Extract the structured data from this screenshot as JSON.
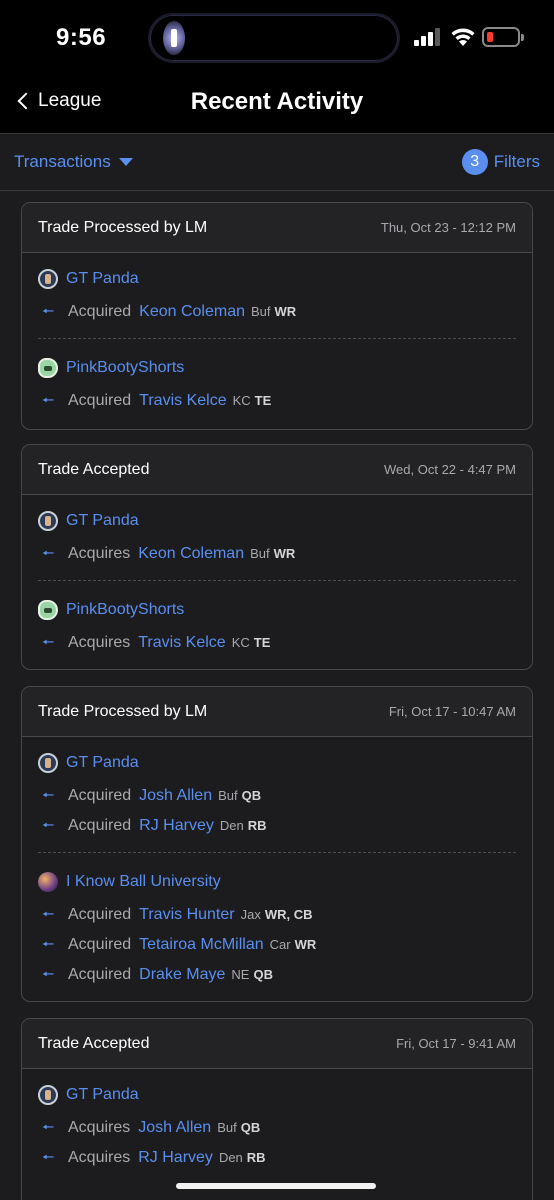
{
  "status": {
    "time": "9:56"
  },
  "nav": {
    "back_label": "League",
    "title": "Recent Activity"
  },
  "filterbar": {
    "transactions_label": "Transactions",
    "filter_count": "3",
    "filters_label": "Filters"
  },
  "colors": {
    "accent": "#5a8ff0",
    "background": "#1c1c1e",
    "header": "#000000",
    "muted_text": "#a9a9ad",
    "battery_low": "#ff3b30"
  },
  "cards": [
    {
      "title": "Trade Processed by LM",
      "date": "Thu, Oct 23 - 12:12 PM",
      "groups": [
        {
          "team": "GT Panda",
          "avatar": "panda-avatar-icon",
          "items": [
            {
              "verb": "Acquired",
              "player": "Keon Coleman",
              "team": "Buf",
              "pos": "WR"
            }
          ]
        },
        {
          "team": "PinkBootyShorts",
          "avatar": "helmet-avatar-icon",
          "items": [
            {
              "verb": "Acquired",
              "player": "Travis Kelce",
              "team": "KC",
              "pos": "TE"
            }
          ]
        }
      ]
    },
    {
      "title": "Trade Accepted",
      "date": "Wed, Oct 22 - 4:47 PM",
      "groups": [
        {
          "team": "GT Panda",
          "avatar": "panda-avatar-icon",
          "items": [
            {
              "verb": "Acquires",
              "player": "Keon Coleman",
              "team": "Buf",
              "pos": "WR"
            }
          ]
        },
        {
          "team": "PinkBootyShorts",
          "avatar": "helmet-avatar-icon",
          "items": [
            {
              "verb": "Acquires",
              "player": "Travis Kelce",
              "team": "KC",
              "pos": "TE"
            }
          ]
        }
      ]
    },
    {
      "title": "Trade Processed by LM",
      "date": "Fri, Oct 17 - 10:47 AM",
      "groups": [
        {
          "team": "GT Panda",
          "avatar": "panda-avatar-icon",
          "items": [
            {
              "verb": "Acquired",
              "player": "Josh Allen",
              "team": "Buf",
              "pos": "QB"
            },
            {
              "verb": "Acquired",
              "player": "RJ Harvey",
              "team": "Den",
              "pos": "RB"
            }
          ]
        },
        {
          "team": "I Know Ball University",
          "avatar": "basketball-avatar-icon",
          "items": [
            {
              "verb": "Acquired",
              "player": "Travis Hunter",
              "team": "Jax",
              "pos": "WR, CB"
            },
            {
              "verb": "Acquired",
              "player": "Tetairoa McMillan",
              "team": "Car",
              "pos": "WR"
            },
            {
              "verb": "Acquired",
              "player": "Drake Maye",
              "team": "NE",
              "pos": "QB"
            }
          ]
        }
      ]
    },
    {
      "title": "Trade Accepted",
      "date": "Fri, Oct 17 - 9:41 AM",
      "groups": [
        {
          "team": "GT Panda",
          "avatar": "panda-avatar-icon",
          "items": [
            {
              "verb": "Acquires",
              "player": "Josh Allen",
              "team": "Buf",
              "pos": "QB"
            },
            {
              "verb": "Acquires",
              "player": "RJ Harvey",
              "team": "Den",
              "pos": "RB"
            }
          ]
        }
      ]
    }
  ]
}
